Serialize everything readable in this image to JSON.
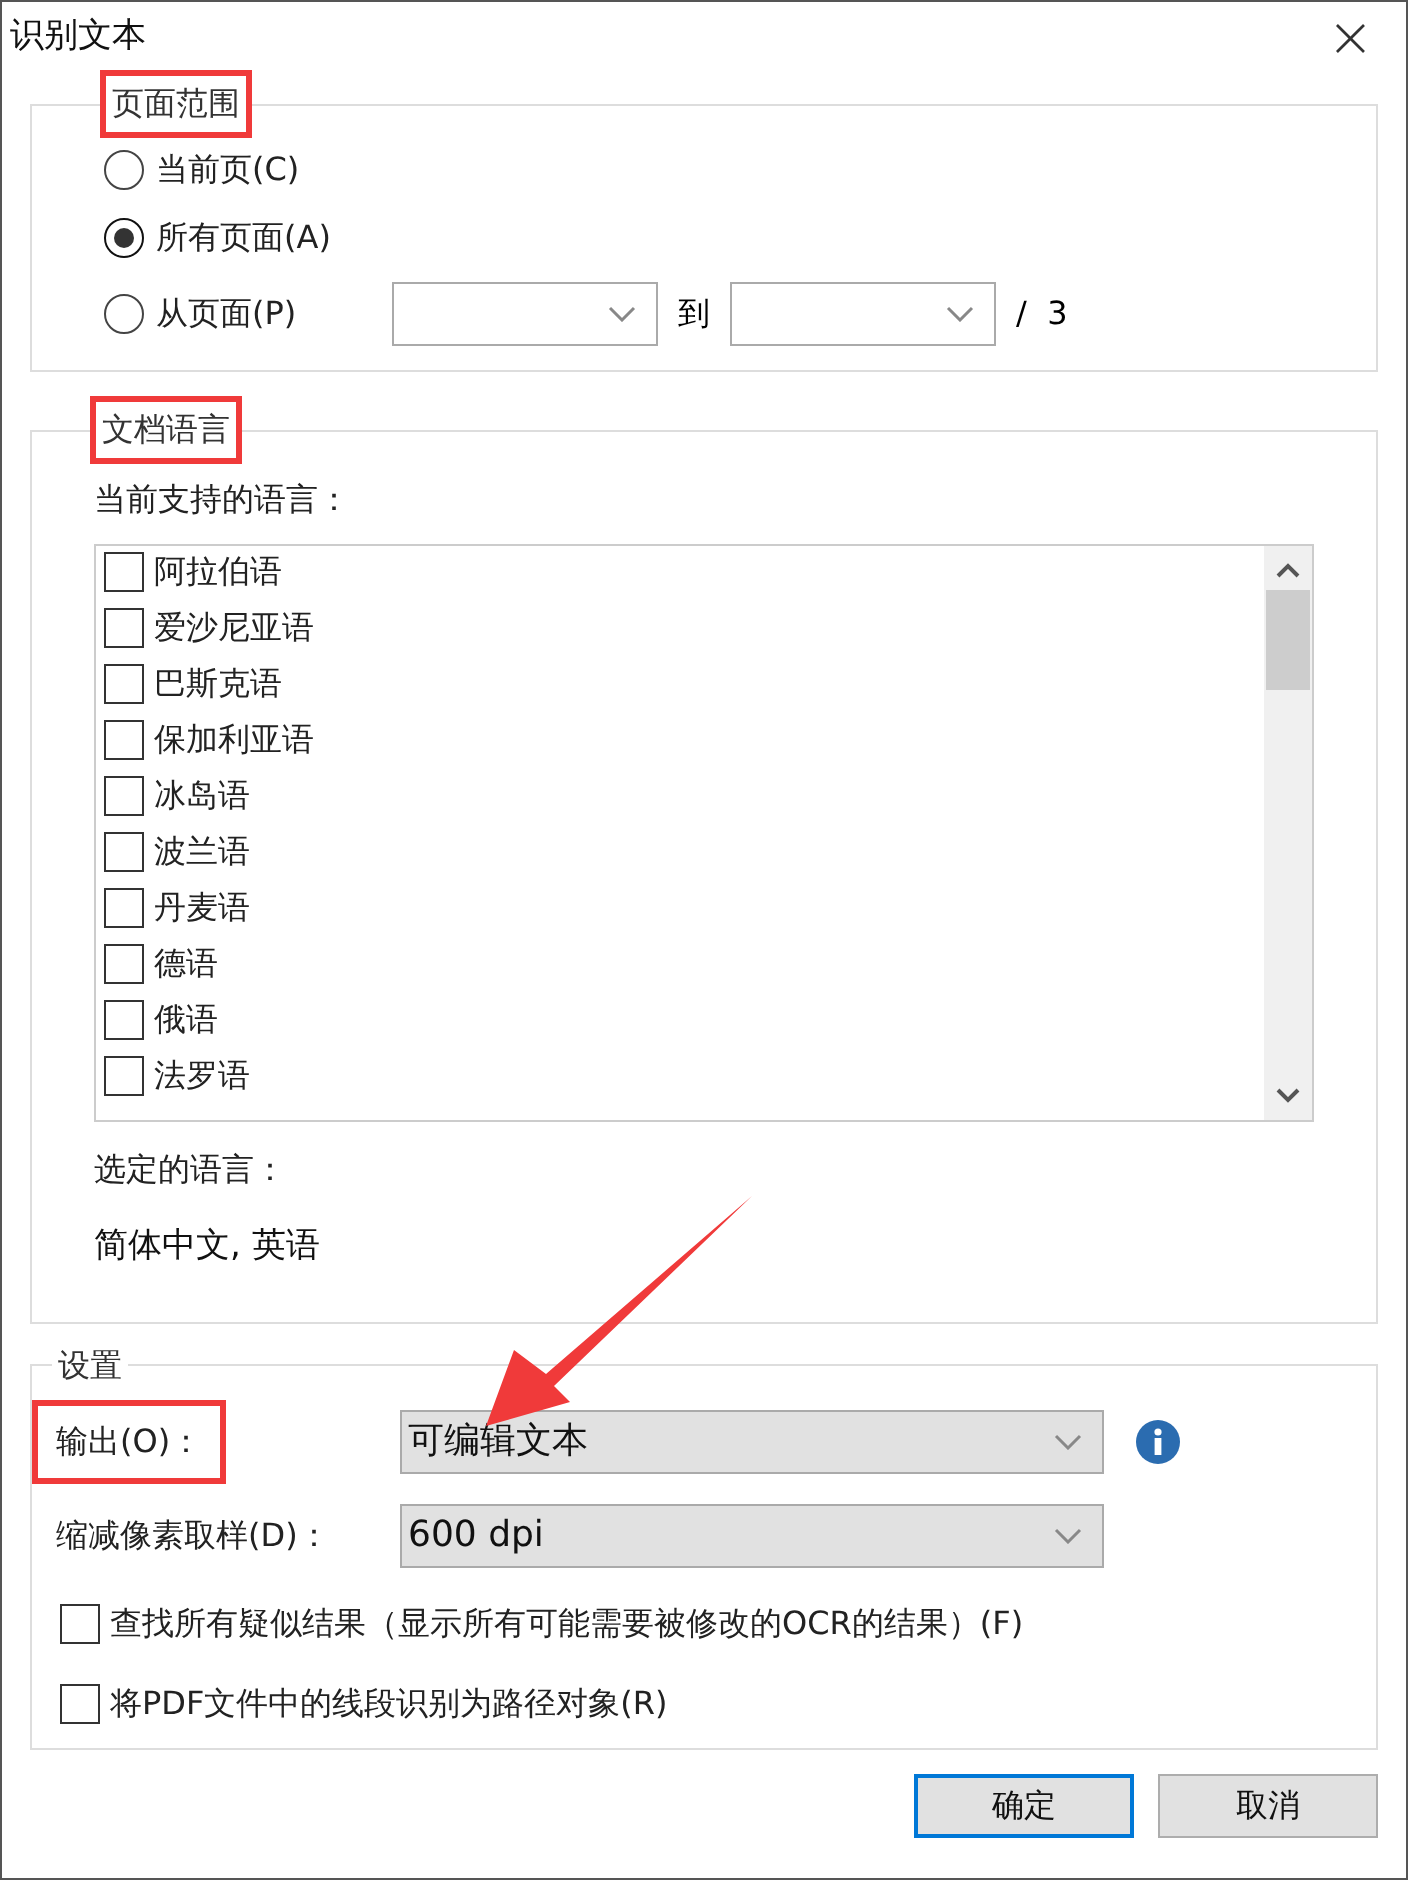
{
  "window": {
    "title": "识别文本",
    "close": "×"
  },
  "page_range": {
    "title": "页面范围",
    "highlighted": true,
    "options": [
      {
        "label": "当前页(C)",
        "selected": false
      },
      {
        "label": "所有页面(A)",
        "selected": true
      },
      {
        "label": "从页面(P)",
        "selected": false
      }
    ],
    "to_label": "到",
    "total": "/  3"
  },
  "language": {
    "title": "文档语言",
    "highlighted": true,
    "supported_label": "当前支持的语言：",
    "items": [
      {
        "label": "阿拉伯语",
        "checked": false
      },
      {
        "label": "爱沙尼亚语",
        "checked": false
      },
      {
        "label": "巴斯克语",
        "checked": false
      },
      {
        "label": "保加利亚语",
        "checked": false
      },
      {
        "label": "冰岛语",
        "checked": false
      },
      {
        "label": "波兰语",
        "checked": false
      },
      {
        "label": "丹麦语",
        "checked": false
      },
      {
        "label": "德语",
        "checked": false
      },
      {
        "label": "俄语",
        "checked": false
      },
      {
        "label": "法罗语",
        "checked": false
      }
    ],
    "selected_label": "选定的语言：",
    "selected_value": "简体中文, 英语"
  },
  "settings": {
    "title": "设置",
    "highlighted": false,
    "output": {
      "label": "输出(O)：",
      "value": "可编辑文本",
      "highlighted": true
    },
    "downsample": {
      "label": "缩减像素取样(D)：",
      "value": "600 dpi",
      "highlighted": false
    },
    "options": [
      {
        "label": "查找所有疑似结果（显示所有可能需要被修改的OCR的结果）(F)",
        "checked": false
      },
      {
        "label": "将PDF文件中的线段识别为路径对象(R)",
        "checked": false
      }
    ]
  },
  "annotation_arrow": true,
  "buttons": [
    {
      "label": "确定",
      "default": true
    },
    {
      "label": "取消",
      "default": false
    }
  ]
}
